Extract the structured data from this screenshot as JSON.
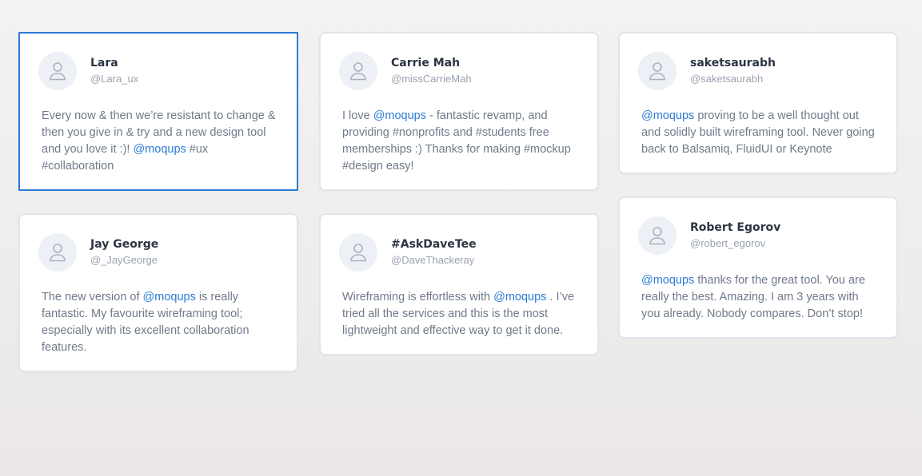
{
  "testimonials": [
    {
      "name": "Lara",
      "handle": "@Lara_ux",
      "selected": true,
      "text": [
        {
          "t": "Every now & then we’re resistant to change & then you give in & try and a new design tool and you love it :)! "
        },
        {
          "t": "@moqups",
          "link": true
        },
        {
          "t": " #ux #collaboration"
        }
      ]
    },
    {
      "name": "Jay George",
      "handle": "@_JayGeorge",
      "text": [
        {
          "t": "The new version of "
        },
        {
          "t": "@moqups",
          "link": true
        },
        {
          "t": " is really fantastic. My favourite wireframing tool; especially with its excellent collaboration features."
        }
      ]
    },
    {
      "name": "Carrie Mah",
      "handle": "@missCarrieMah",
      "text": [
        {
          "t": "I love "
        },
        {
          "t": "@moqups",
          "link": true
        },
        {
          "t": " - fantastic revamp, and providing #nonprofits and #students free memberships :) Thanks for making #mockup #design easy!"
        }
      ]
    },
    {
      "name": "#AskDaveTee",
      "handle": "@DaveThackeray",
      "text": [
        {
          "t": "Wireframing is effortless with "
        },
        {
          "t": "@moqups",
          "link": true
        },
        {
          "t": " . I’ve tried all the services and this is the most lightweight and effective way to get it done."
        }
      ]
    },
    {
      "name": "saketsaurabh",
      "handle": "@saketsaurabh",
      "text": [
        {
          "t": "@moqups",
          "link": true
        },
        {
          "t": " proving to be a well thought out and solidly built wireframing tool. Never going back to Balsamiq, FluidUI or Keynote"
        }
      ]
    },
    {
      "name": "Robert Egorov",
      "handle": "@robert_egorov",
      "text": [
        {
          "t": "@moqups",
          "link": true
        },
        {
          "t": " thanks for the great tool. You are really the best. Amazing. I am 3 years with you already. Nobody compares.  Don’t stop!"
        }
      ]
    }
  ],
  "icons": {
    "avatar": "user-placeholder-icon"
  },
  "colors": {
    "accent": "#2b7bd6",
    "card_border": "#e1e5eb",
    "name": "#2c3542",
    "body_text": "#6f7a8a",
    "handle": "#9aa3b0"
  }
}
